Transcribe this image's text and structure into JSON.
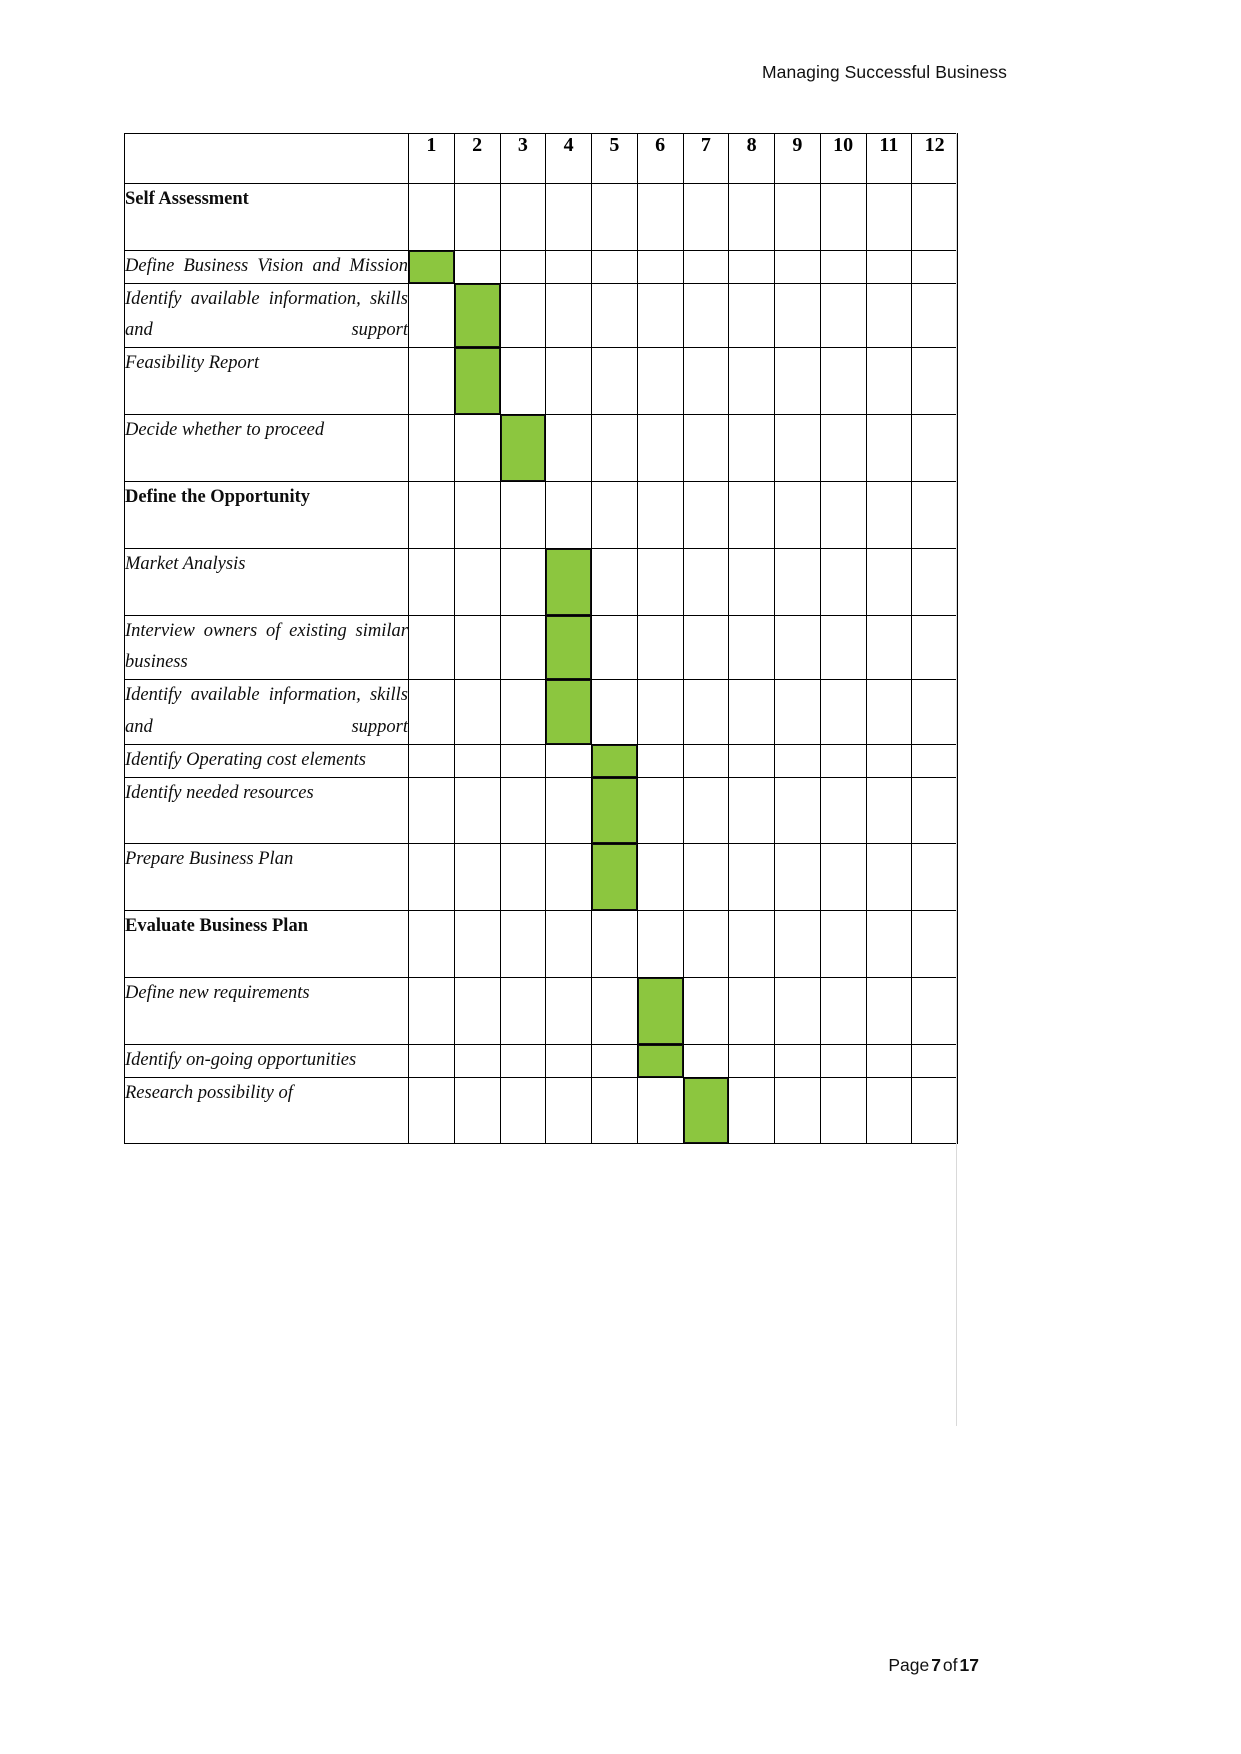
{
  "header": {
    "title": "Managing Successful Business"
  },
  "footer": {
    "page_word": "Page",
    "page_number": "7",
    "of_word": "of",
    "total_pages": "17"
  },
  "colors": {
    "bar_green": "#8CC63F",
    "bar_outline": "#111111",
    "grid": "#000000"
  },
  "chart_data": {
    "type": "gantt",
    "title": "",
    "xlabel": "",
    "ylabel": "",
    "month_headers": [
      "1",
      "2",
      "3",
      "4",
      "5",
      "6",
      "7",
      "8",
      "9",
      "10",
      "11",
      "12"
    ],
    "corner_label": "",
    "rows": [
      {
        "label": "Self Assessment",
        "kind": "section",
        "start": null,
        "end": null
      },
      {
        "label": "Define Business Vision and Mission",
        "kind": "task",
        "start": 1,
        "end": 1
      },
      {
        "label": "Identify available information, skills and support",
        "kind": "task",
        "start": 2,
        "end": 2
      },
      {
        "label": "Feasibility Report",
        "kind": "task",
        "start": 2,
        "end": 2
      },
      {
        "label": "Decide whether to proceed",
        "kind": "task",
        "start": 3,
        "end": 3
      },
      {
        "label": "Define the Opportunity",
        "kind": "section",
        "start": null,
        "end": null
      },
      {
        "label": "Market Analysis",
        "kind": "task",
        "start": 4,
        "end": 4
      },
      {
        "label": "Interview owners of existing similar business",
        "kind": "task",
        "start": 4,
        "end": 4
      },
      {
        "label": "Identify available information, skills and support",
        "kind": "task",
        "start": 4,
        "end": 4
      },
      {
        "label": "Identify Operating cost elements",
        "kind": "task",
        "start": 5,
        "end": 5
      },
      {
        "label": "Identify needed resources",
        "kind": "task",
        "start": 5,
        "end": 5
      },
      {
        "label": "Prepare Business Plan",
        "kind": "task",
        "start": 5,
        "end": 5
      },
      {
        "label": "Evaluate Business Plan",
        "kind": "section",
        "start": null,
        "end": null
      },
      {
        "label": "Define new requirements",
        "kind": "task",
        "start": 6,
        "end": 6
      },
      {
        "label": "Identify on-going opportunities",
        "kind": "task",
        "start": 6,
        "end": 6
      },
      {
        "label": "Research possibility of",
        "kind": "task",
        "start": 7,
        "end": 7
      }
    ]
  }
}
